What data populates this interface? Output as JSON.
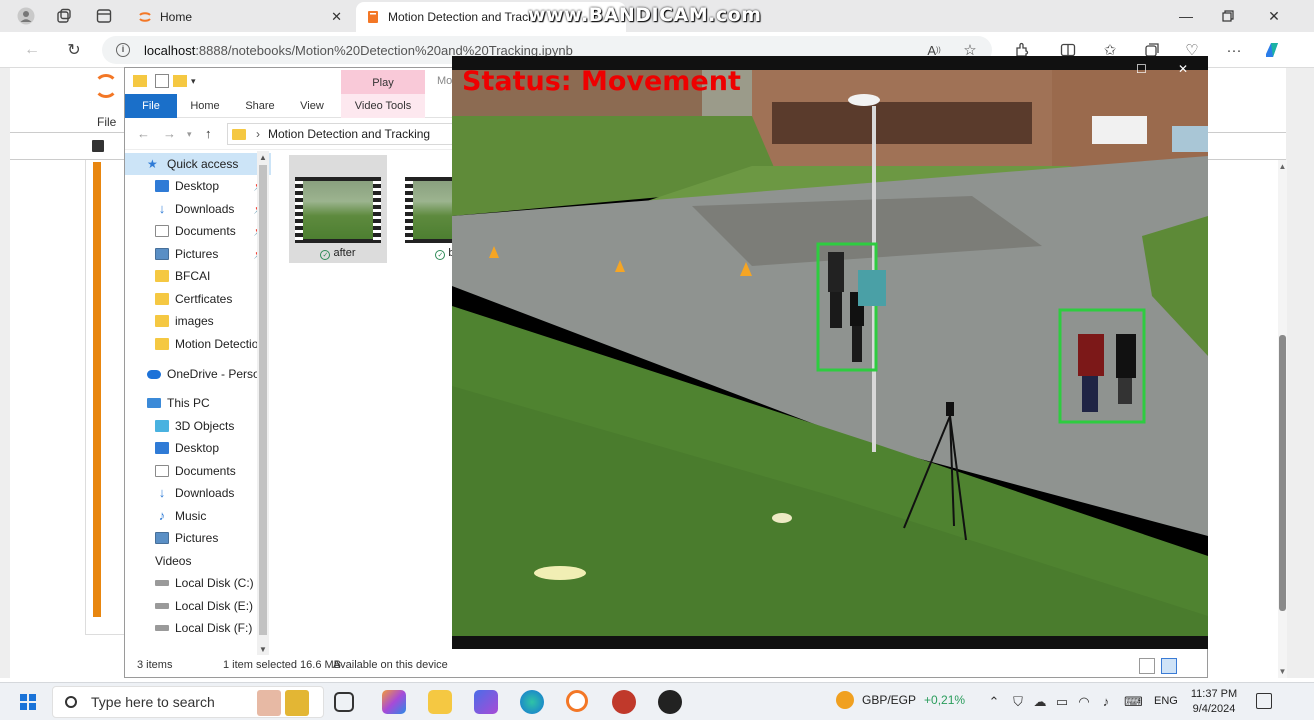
{
  "browser": {
    "tabs": [
      {
        "label": "Home"
      },
      {
        "label": "Motion Detection and Tracki"
      }
    ],
    "watermark": "www.BANDICAM.com",
    "url_host": "localhost",
    "url_path": ":8888/notebooks/Motion%20Detection%20and%20Tracking.ipynb"
  },
  "jupyter": {
    "menu_file": "File"
  },
  "explorer": {
    "contextual_tab": "Play",
    "mo_fragment": "Mo",
    "ribbon": {
      "file": "File",
      "home": "Home",
      "share": "Share",
      "view": "View",
      "video_tools": "Video Tools"
    },
    "path": "Motion Detection and Tracking",
    "nav": [
      {
        "label": "Quick access",
        "icon": "star-icon",
        "selected": true
      },
      {
        "label": "Desktop",
        "icon": "desktop-icon",
        "pinned": true
      },
      {
        "label": "Downloads",
        "icon": "download-icon",
        "pinned": true
      },
      {
        "label": "Documents",
        "icon": "document-icon",
        "pinned": true
      },
      {
        "label": "Pictures",
        "icon": "pictures-icon",
        "pinned": true
      },
      {
        "label": "BFCAI",
        "icon": "folder-icon"
      },
      {
        "label": "Certficates",
        "icon": "folder-icon"
      },
      {
        "label": "images",
        "icon": "folder-icon"
      },
      {
        "label": "Motion Detectio",
        "icon": "folder-icon"
      },
      {
        "label": "OneDrive - Persor",
        "icon": "cloud-icon"
      },
      {
        "label": "This PC",
        "icon": "pc-icon"
      },
      {
        "label": "3D Objects",
        "icon": "cube-icon"
      },
      {
        "label": "Desktop",
        "icon": "desktop-icon"
      },
      {
        "label": "Documents",
        "icon": "document-icon"
      },
      {
        "label": "Downloads",
        "icon": "download-icon"
      },
      {
        "label": "Music",
        "icon": "music-icon"
      },
      {
        "label": "Pictures",
        "icon": "pictures-icon"
      },
      {
        "label": "Videos",
        "icon": "video-icon"
      },
      {
        "label": "Local Disk (C:)",
        "icon": "disk-icon"
      },
      {
        "label": "Local Disk (E:)",
        "icon": "disk-icon"
      },
      {
        "label": "Local Disk (F:)",
        "icon": "disk-icon"
      }
    ],
    "files": [
      {
        "label": "after",
        "selected": true
      },
      {
        "label": "be",
        "selected": false
      }
    ],
    "status": {
      "count": "3 items",
      "selection": "1 item selected  16.6 MB",
      "availability": "Available on this device"
    }
  },
  "video": {
    "status_text": "Status: Movement",
    "status_color": "#e00000",
    "box_color": "#2ecc40"
  },
  "taskbar": {
    "search_placeholder": "Type here to search",
    "ticker": "GBP/EGP",
    "ticker_change": "+0,21%",
    "language": "ENG",
    "time": "11:37 PM",
    "date": "9/4/2024"
  }
}
